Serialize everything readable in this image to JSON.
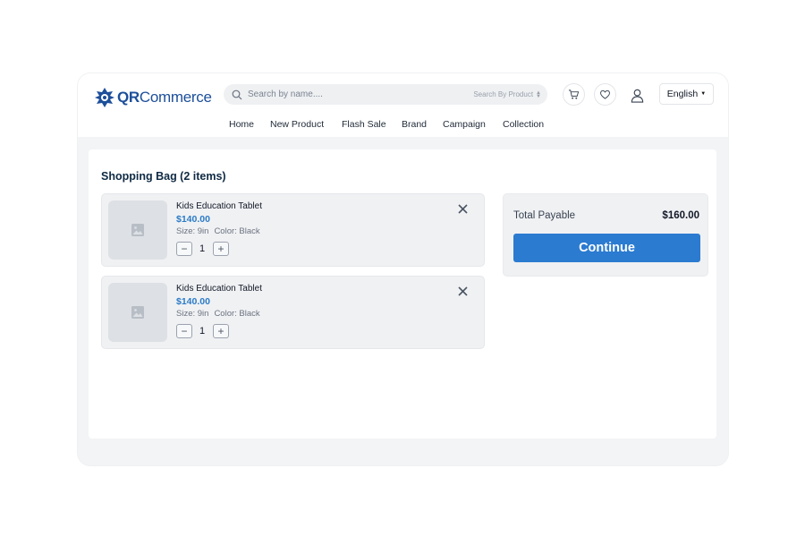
{
  "brand": {
    "logo_text_qr": "QR",
    "logo_text_rest": "Commerce",
    "accent": "#1d4f9a"
  },
  "search": {
    "placeholder": "Search by name....",
    "scope_label": "Search By Product"
  },
  "header_icons": [
    "cart-icon",
    "heart-icon",
    "user-icon"
  ],
  "language": {
    "selected": "English"
  },
  "nav": {
    "items": [
      "Home",
      "New Product",
      "Flash Sale",
      "Brand",
      "Campaign",
      "Collection"
    ]
  },
  "bag": {
    "title": "Shopping Bag (2 items)",
    "items": [
      {
        "name": "Kids Education Tablet",
        "price": "$140.00",
        "size": "Size: 9in",
        "color": "Color: Black",
        "qty": "1"
      },
      {
        "name": "Kids Education Tablet",
        "price": "$140.00",
        "size": "Size: 9in",
        "color": "Color: Black",
        "qty": "1"
      }
    ]
  },
  "summary": {
    "total_label": "Total Payable",
    "total_value": "$160.00",
    "continue_label": "Continue"
  },
  "colors": {
    "primary_button": "#2b7bd1",
    "price": "#2b7bc7",
    "heading": "#0f2a44"
  }
}
